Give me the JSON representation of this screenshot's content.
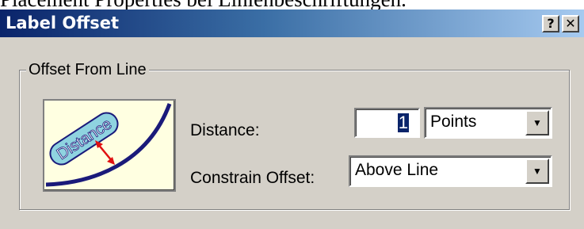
{
  "caption": "Placement Properties bei Linienbeschriftungen.",
  "dialog": {
    "title": "Label Offset",
    "help_label": "?",
    "close_label": "✕"
  },
  "group": {
    "legend": "Offset From Line",
    "preview_label": "Distance",
    "distance": {
      "label": "Distance:",
      "value": "1",
      "units": "Points"
    },
    "constrain": {
      "label": "Constrain Offset:",
      "value": "Above Line"
    }
  },
  "icons": {
    "dropdown": "chevron-down-icon"
  },
  "colors": {
    "titlebar_start": "#0a246a",
    "titlebar_end": "#a6caf0",
    "dialog_bg": "#d4d0c8",
    "preview_bg": "#ffffe1",
    "preview_line": "#1a1a7a",
    "preview_arrow": "#e01010",
    "preview_label_fill": "#8fd3e0"
  }
}
